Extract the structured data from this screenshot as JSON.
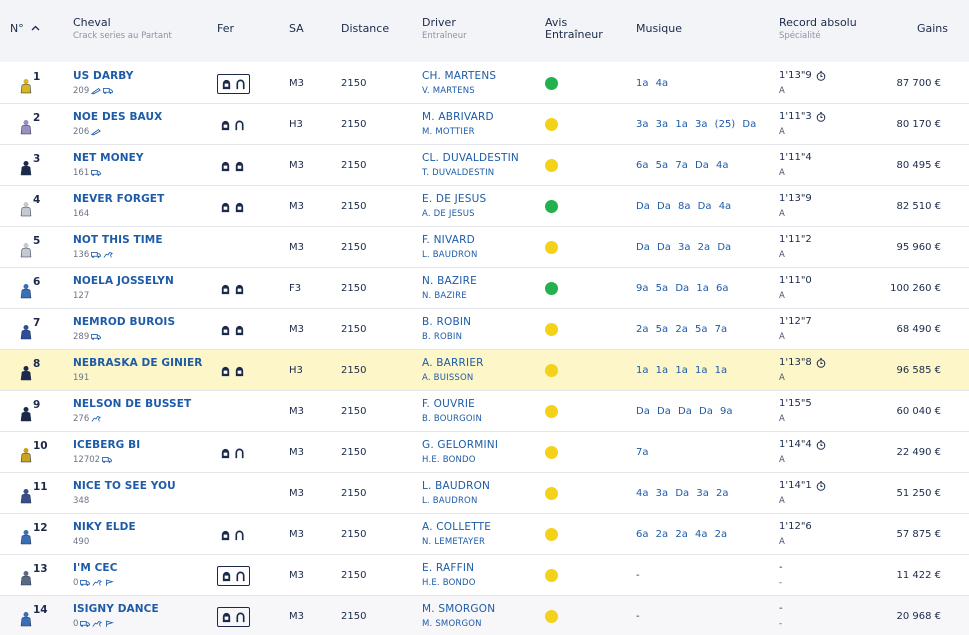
{
  "header": {
    "num": "N°",
    "cheval": "Cheval",
    "cheval_sub": "Crack series au Partant",
    "fer": "Fer",
    "sa": "SA",
    "distance": "Distance",
    "driver": "Driver",
    "driver_sub": "Entraîneur",
    "avis": "Avis Entraîneur",
    "musique": "Musique",
    "record": "Record absolu",
    "record_sub": "Spécialité",
    "gains": "Gains"
  },
  "colors": {
    "link": "#1d5ba8",
    "highlight_row": "#fdf6c8",
    "happy": "#22b14c",
    "neutral": "#f5d21a"
  },
  "rows": [
    {
      "num": "1",
      "horse": "US DARBY",
      "sub": "209",
      "sub_icons": [
        "whip-icon",
        "truck-icon"
      ],
      "fer": [
        "lock-shoe-icon",
        "horseshoe-icon"
      ],
      "fer_boxed": true,
      "sa": "M3",
      "distance": "2150",
      "driver": "CH. MARTENS",
      "trainer": "V. MARTENS",
      "avis": "happy",
      "musique": "1a  4a",
      "record": "1'13\"9",
      "record_icon": true,
      "spec": "A",
      "gains": "87 700 €"
    },
    {
      "num": "2",
      "horse": "NOE DES BAUX",
      "sub": "206",
      "sub_icons": [
        "whip-icon"
      ],
      "fer": [
        "lock-shoe-icon",
        "horseshoe-icon"
      ],
      "fer_boxed": false,
      "sa": "H3",
      "distance": "2150",
      "driver": "M. ABRIVARD",
      "trainer": "M. MOTTIER",
      "avis": "neutral",
      "musique": "3a  3a  1a  3a  (25) Da",
      "record": "1'11\"3",
      "record_icon": true,
      "spec": "A",
      "gains": "80 170 €"
    },
    {
      "num": "3",
      "horse": "NET MONEY",
      "sub": "161",
      "sub_icons": [
        "truck-icon"
      ],
      "fer": [
        "lock-shoe-icon",
        "lock-shoe-icon"
      ],
      "fer_boxed": false,
      "sa": "M3",
      "distance": "2150",
      "driver": "CL. DUVALDESTIN",
      "trainer": "T. DUVALDESTIN",
      "avis": "neutral",
      "musique": "6a  5a  7a  Da  4a",
      "record": "1'11\"4",
      "record_icon": false,
      "spec": "A",
      "gains": "80 495 €"
    },
    {
      "num": "4",
      "horse": "NEVER FORGET",
      "sub": "164",
      "sub_icons": [],
      "fer": [
        "lock-shoe-icon",
        "lock-shoe-icon"
      ],
      "fer_boxed": false,
      "sa": "M3",
      "distance": "2150",
      "driver": "E. DE JESUS",
      "trainer": "A. DE JESUS",
      "avis": "happy",
      "musique": "Da  Da  8a  Da  4a",
      "record": "1'13\"9",
      "record_icon": false,
      "spec": "A",
      "gains": "82 510 €"
    },
    {
      "num": "5",
      "horse": "NOT THIS TIME",
      "sub": "136",
      "sub_icons": [
        "truck-icon",
        "horse-icon"
      ],
      "fer": [],
      "fer_boxed": false,
      "sa": "M3",
      "distance": "2150",
      "driver": "F. NIVARD",
      "trainer": "L. BAUDRON",
      "avis": "neutral",
      "musique": "Da  Da  3a  2a  Da",
      "record": "1'11\"2",
      "record_icon": false,
      "spec": "A",
      "gains": "95 960 €"
    },
    {
      "num": "6",
      "horse": "NOELA JOSSELYN",
      "sub": "127",
      "sub_icons": [],
      "fer": [
        "lock-shoe-icon",
        "lock-shoe-icon"
      ],
      "fer_boxed": false,
      "sa": "F3",
      "distance": "2150",
      "driver": "N. BAZIRE",
      "trainer": "N. BAZIRE",
      "avis": "happy",
      "musique": "9a  5a  Da  1a  6a",
      "record": "1'11\"0",
      "record_icon": false,
      "spec": "A",
      "gains": "100 260 €"
    },
    {
      "num": "7",
      "horse": "NEMROD BUROIS",
      "sub": "289",
      "sub_icons": [
        "truck-icon"
      ],
      "fer": [
        "lock-shoe-icon",
        "lock-shoe-icon"
      ],
      "fer_boxed": false,
      "sa": "M3",
      "distance": "2150",
      "driver": "B. ROBIN",
      "trainer": "B. ROBIN",
      "avis": "neutral",
      "musique": "2a  5a  2a  5a  7a",
      "record": "1'12\"7",
      "record_icon": false,
      "spec": "A",
      "gains": "68 490 €"
    },
    {
      "num": "8",
      "horse": "NEBRASKA DE GINIER",
      "sub": "191",
      "sub_icons": [],
      "fer": [
        "lock-shoe-icon",
        "lock-shoe-icon"
      ],
      "fer_boxed": false,
      "sa": "H3",
      "distance": "2150",
      "driver": "A. BARRIER",
      "trainer": "A. BUISSON",
      "avis": "neutral",
      "musique": "1a  1a  1a  1a  1a",
      "record": "1'13\"8",
      "record_icon": true,
      "spec": "A",
      "gains": "96 585 €",
      "highlight": true
    },
    {
      "num": "9",
      "horse": "NELSON DE BUSSET",
      "sub": "276",
      "sub_icons": [
        "horse-icon"
      ],
      "fer": [],
      "fer_boxed": false,
      "sa": "M3",
      "distance": "2150",
      "driver": "F. OUVRIE",
      "trainer": "B. BOURGOIN",
      "avis": "neutral",
      "musique": "Da  Da  Da  Da  9a",
      "record": "1'15\"5",
      "record_icon": false,
      "spec": "A",
      "gains": "60 040 €"
    },
    {
      "num": "10",
      "horse": "ICEBERG BI",
      "sub": "12702",
      "sub_icons": [
        "truck-icon"
      ],
      "fer": [
        "lock-shoe-icon",
        "horseshoe-icon"
      ],
      "fer_boxed": false,
      "sa": "M3",
      "distance": "2150",
      "driver": "G. GELORMINI",
      "trainer": "H.E. BONDO",
      "avis": "neutral",
      "musique": "7a",
      "record": "1'14\"4",
      "record_icon": true,
      "spec": "A",
      "gains": "22 490 €"
    },
    {
      "num": "11",
      "horse": "NICE TO SEE YOU",
      "sub": "348",
      "sub_icons": [],
      "fer": [],
      "fer_boxed": false,
      "sa": "M3",
      "distance": "2150",
      "driver": "L. BAUDRON",
      "trainer": "L. BAUDRON",
      "avis": "neutral",
      "musique": "4a  3a  Da  3a  2a",
      "record": "1'14\"1",
      "record_icon": true,
      "spec": "A",
      "gains": "51 250 €"
    },
    {
      "num": "12",
      "horse": "NIKY ELDE",
      "sub": "490",
      "sub_icons": [],
      "fer": [
        "lock-shoe-icon",
        "horseshoe-icon"
      ],
      "fer_boxed": false,
      "sa": "M3",
      "distance": "2150",
      "driver": "A. COLLETTE",
      "trainer": "N. LEMETAYER",
      "avis": "neutral",
      "musique": "6a  2a  2a  4a  2a",
      "record": "1'12\"6",
      "record_icon": false,
      "spec": "A",
      "gains": "57 875 €"
    },
    {
      "num": "13",
      "horse": "I'M CEC",
      "sub": "0",
      "sub_icons": [
        "truck-icon",
        "horse-icon",
        "flag-icon"
      ],
      "fer": [
        "lock-shoe-icon",
        "horseshoe-icon"
      ],
      "fer_boxed": true,
      "sa": "M3",
      "distance": "2150",
      "driver": "E. RAFFIN",
      "trainer": "H.E. BONDO",
      "avis": "neutral",
      "musique": "-",
      "record": "-",
      "record_icon": false,
      "spec": "-",
      "gains": "11 422 €"
    },
    {
      "num": "14",
      "horse": "ISIGNY DANCE",
      "sub": "0",
      "sub_icons": [
        "truck-icon",
        "horse-icon",
        "flag-icon"
      ],
      "fer": [
        "lock-shoe-icon",
        "horseshoe-icon"
      ],
      "fer_boxed": true,
      "sa": "M3",
      "distance": "2150",
      "driver": "M. SMORGON",
      "trainer": "M. SMORGON",
      "avis": "neutral",
      "musique": "-",
      "record": "-",
      "record_icon": false,
      "spec": "-",
      "gains": "20 968 €",
      "alt": true
    }
  ]
}
